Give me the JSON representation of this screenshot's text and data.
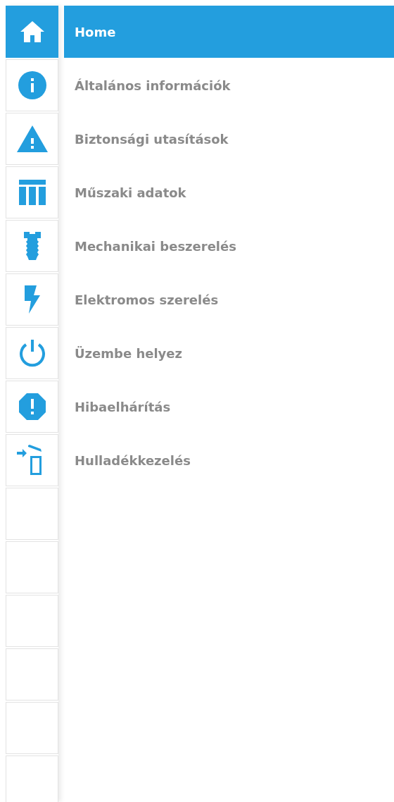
{
  "menu": [
    {
      "kind": "home",
      "label": "Home",
      "selected": true
    },
    {
      "kind": "info",
      "label": "Általános információk",
      "selected": false
    },
    {
      "kind": "warning",
      "label": "Biztonsági utasítások",
      "selected": false
    },
    {
      "kind": "table",
      "label": "Műszaki adatok",
      "selected": false
    },
    {
      "kind": "screw",
      "label": "Mechanikai beszerelés",
      "selected": false
    },
    {
      "kind": "bolt",
      "label": "Elektromos szerelés",
      "selected": false
    },
    {
      "kind": "power",
      "label": "Üzembe helyez",
      "selected": false
    },
    {
      "kind": "alert",
      "label": "Hibaelhárítás",
      "selected": false
    },
    {
      "kind": "disposal",
      "label": "Hulladékkezelés",
      "selected": false
    }
  ]
}
